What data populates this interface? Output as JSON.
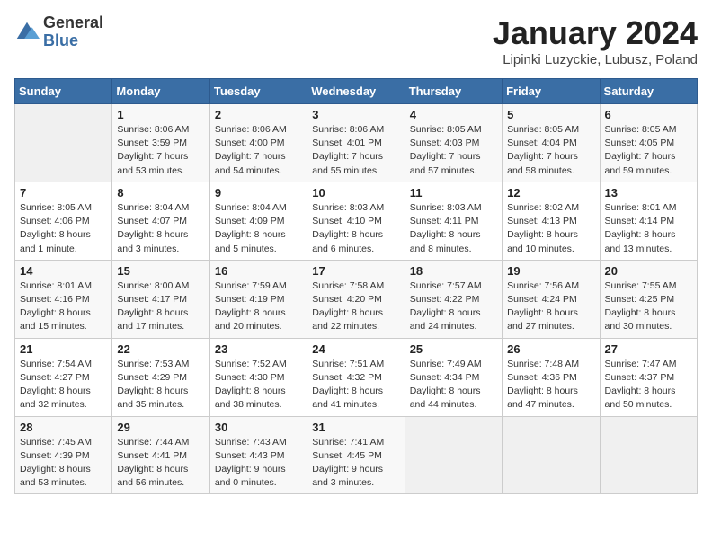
{
  "logo": {
    "general": "General",
    "blue": "Blue"
  },
  "title": "January 2024",
  "location": "Lipinki Luzyckie, Lubusz, Poland",
  "weekdays": [
    "Sunday",
    "Monday",
    "Tuesday",
    "Wednesday",
    "Thursday",
    "Friday",
    "Saturday"
  ],
  "weeks": [
    [
      {
        "day": "",
        "content": ""
      },
      {
        "day": "1",
        "content": "Sunrise: 8:06 AM\nSunset: 3:59 PM\nDaylight: 7 hours\nand 53 minutes."
      },
      {
        "day": "2",
        "content": "Sunrise: 8:06 AM\nSunset: 4:00 PM\nDaylight: 7 hours\nand 54 minutes."
      },
      {
        "day": "3",
        "content": "Sunrise: 8:06 AM\nSunset: 4:01 PM\nDaylight: 7 hours\nand 55 minutes."
      },
      {
        "day": "4",
        "content": "Sunrise: 8:05 AM\nSunset: 4:03 PM\nDaylight: 7 hours\nand 57 minutes."
      },
      {
        "day": "5",
        "content": "Sunrise: 8:05 AM\nSunset: 4:04 PM\nDaylight: 7 hours\nand 58 minutes."
      },
      {
        "day": "6",
        "content": "Sunrise: 8:05 AM\nSunset: 4:05 PM\nDaylight: 7 hours\nand 59 minutes."
      }
    ],
    [
      {
        "day": "7",
        "content": "Sunrise: 8:05 AM\nSunset: 4:06 PM\nDaylight: 8 hours\nand 1 minute."
      },
      {
        "day": "8",
        "content": "Sunrise: 8:04 AM\nSunset: 4:07 PM\nDaylight: 8 hours\nand 3 minutes."
      },
      {
        "day": "9",
        "content": "Sunrise: 8:04 AM\nSunset: 4:09 PM\nDaylight: 8 hours\nand 5 minutes."
      },
      {
        "day": "10",
        "content": "Sunrise: 8:03 AM\nSunset: 4:10 PM\nDaylight: 8 hours\nand 6 minutes."
      },
      {
        "day": "11",
        "content": "Sunrise: 8:03 AM\nSunset: 4:11 PM\nDaylight: 8 hours\nand 8 minutes."
      },
      {
        "day": "12",
        "content": "Sunrise: 8:02 AM\nSunset: 4:13 PM\nDaylight: 8 hours\nand 10 minutes."
      },
      {
        "day": "13",
        "content": "Sunrise: 8:01 AM\nSunset: 4:14 PM\nDaylight: 8 hours\nand 13 minutes."
      }
    ],
    [
      {
        "day": "14",
        "content": "Sunrise: 8:01 AM\nSunset: 4:16 PM\nDaylight: 8 hours\nand 15 minutes."
      },
      {
        "day": "15",
        "content": "Sunrise: 8:00 AM\nSunset: 4:17 PM\nDaylight: 8 hours\nand 17 minutes."
      },
      {
        "day": "16",
        "content": "Sunrise: 7:59 AM\nSunset: 4:19 PM\nDaylight: 8 hours\nand 20 minutes."
      },
      {
        "day": "17",
        "content": "Sunrise: 7:58 AM\nSunset: 4:20 PM\nDaylight: 8 hours\nand 22 minutes."
      },
      {
        "day": "18",
        "content": "Sunrise: 7:57 AM\nSunset: 4:22 PM\nDaylight: 8 hours\nand 24 minutes."
      },
      {
        "day": "19",
        "content": "Sunrise: 7:56 AM\nSunset: 4:24 PM\nDaylight: 8 hours\nand 27 minutes."
      },
      {
        "day": "20",
        "content": "Sunrise: 7:55 AM\nSunset: 4:25 PM\nDaylight: 8 hours\nand 30 minutes."
      }
    ],
    [
      {
        "day": "21",
        "content": "Sunrise: 7:54 AM\nSunset: 4:27 PM\nDaylight: 8 hours\nand 32 minutes."
      },
      {
        "day": "22",
        "content": "Sunrise: 7:53 AM\nSunset: 4:29 PM\nDaylight: 8 hours\nand 35 minutes."
      },
      {
        "day": "23",
        "content": "Sunrise: 7:52 AM\nSunset: 4:30 PM\nDaylight: 8 hours\nand 38 minutes."
      },
      {
        "day": "24",
        "content": "Sunrise: 7:51 AM\nSunset: 4:32 PM\nDaylight: 8 hours\nand 41 minutes."
      },
      {
        "day": "25",
        "content": "Sunrise: 7:49 AM\nSunset: 4:34 PM\nDaylight: 8 hours\nand 44 minutes."
      },
      {
        "day": "26",
        "content": "Sunrise: 7:48 AM\nSunset: 4:36 PM\nDaylight: 8 hours\nand 47 minutes."
      },
      {
        "day": "27",
        "content": "Sunrise: 7:47 AM\nSunset: 4:37 PM\nDaylight: 8 hours\nand 50 minutes."
      }
    ],
    [
      {
        "day": "28",
        "content": "Sunrise: 7:45 AM\nSunset: 4:39 PM\nDaylight: 8 hours\nand 53 minutes."
      },
      {
        "day": "29",
        "content": "Sunrise: 7:44 AM\nSunset: 4:41 PM\nDaylight: 8 hours\nand 56 minutes."
      },
      {
        "day": "30",
        "content": "Sunrise: 7:43 AM\nSunset: 4:43 PM\nDaylight: 9 hours\nand 0 minutes."
      },
      {
        "day": "31",
        "content": "Sunrise: 7:41 AM\nSunset: 4:45 PM\nDaylight: 9 hours\nand 3 minutes."
      },
      {
        "day": "",
        "content": ""
      },
      {
        "day": "",
        "content": ""
      },
      {
        "day": "",
        "content": ""
      }
    ]
  ]
}
